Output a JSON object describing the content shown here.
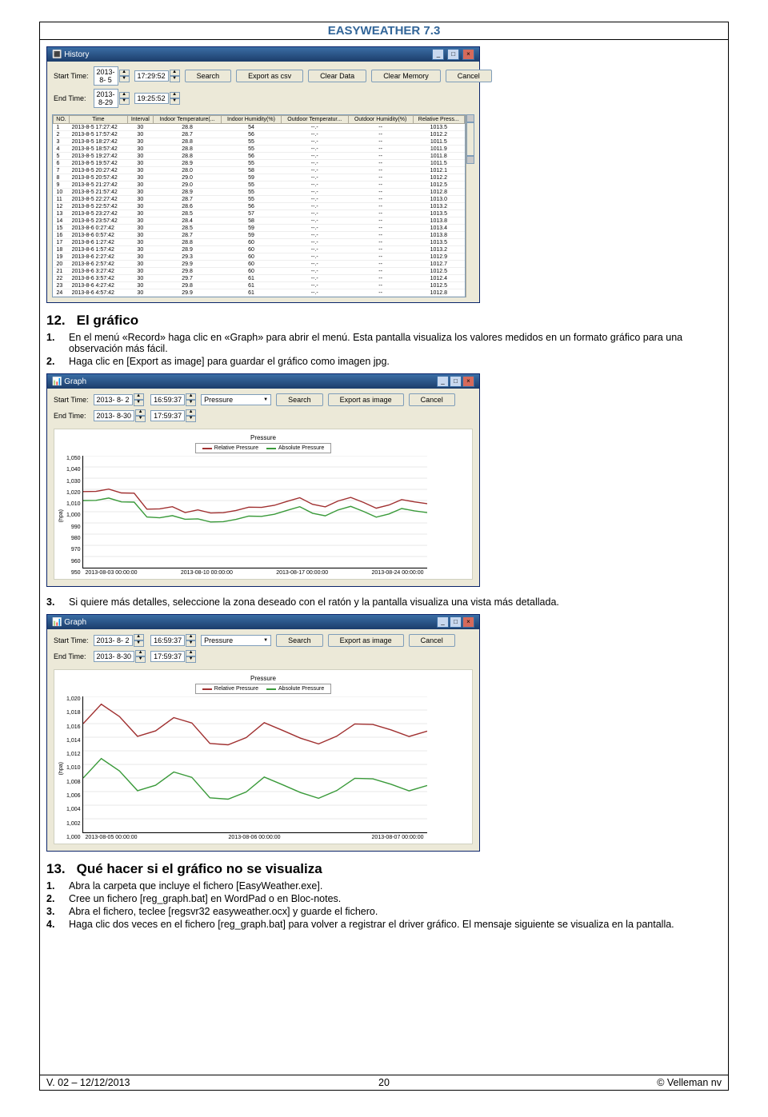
{
  "headerTitle": "EASYWEATHER 7.3",
  "footer": {
    "left": "V. 02 – 12/12/2013",
    "page": "20",
    "right": "© Velleman nv"
  },
  "historyWin": {
    "title": "History",
    "startLabel": "Start Time:",
    "endLabel": "End Time:",
    "startDate": "2013- 8-  5",
    "startTime": "17:29:52",
    "endDate": "2013- 8-29",
    "endTime": "19:25:52",
    "btnSearch": "Search",
    "btnExportCsv": "Export as csv",
    "btnClearData": "Clear Data",
    "btnClearMem": "Clear Memory",
    "btnCancel": "Cancel",
    "headers": [
      "NO.",
      "Time",
      "Interval",
      "Indoor Temperature(...",
      "Indoor Humidity(%)",
      "Outdoor Temperatur...",
      "Outdoor Humidity(%)",
      "Relative Press..."
    ],
    "rows": [
      [
        "1",
        "2013-8-5 17:27:42",
        "30",
        "28.8",
        "54",
        "--.-",
        "--",
        "1013.5"
      ],
      [
        "2",
        "2013-8-5 17:57:42",
        "30",
        "28.7",
        "56",
        "--.-",
        "--",
        "1012.2"
      ],
      [
        "3",
        "2013-8-5 18:27:42",
        "30",
        "28.8",
        "55",
        "--.-",
        "--",
        "1011.5"
      ],
      [
        "4",
        "2013-8-5 18:57:42",
        "30",
        "28.8",
        "55",
        "--.-",
        "--",
        "1011.9"
      ],
      [
        "5",
        "2013-8-5 19:27:42",
        "30",
        "28.8",
        "56",
        "--.-",
        "--",
        "1011.8"
      ],
      [
        "6",
        "2013-8-5 19:57:42",
        "30",
        "28.9",
        "55",
        "--.-",
        "--",
        "1011.5"
      ],
      [
        "7",
        "2013-8-5 20:27:42",
        "30",
        "28.0",
        "58",
        "--.-",
        "--",
        "1012.1"
      ],
      [
        "8",
        "2013-8-5 20:57:42",
        "30",
        "29.0",
        "59",
        "--.-",
        "--",
        "1012.2"
      ],
      [
        "9",
        "2013-8-5 21:27:42",
        "30",
        "29.0",
        "55",
        "--.-",
        "--",
        "1012.5"
      ],
      [
        "10",
        "2013-8-5 21:57:42",
        "30",
        "28.9",
        "55",
        "--.-",
        "--",
        "1012.8"
      ],
      [
        "11",
        "2013-8-5 22:27:42",
        "30",
        "28.7",
        "55",
        "--.-",
        "--",
        "1013.0"
      ],
      [
        "12",
        "2013-8-5 22:57:42",
        "30",
        "28.6",
        "56",
        "--.-",
        "--",
        "1013.2"
      ],
      [
        "13",
        "2013-8-5 23:27:42",
        "30",
        "28.5",
        "57",
        "--.-",
        "--",
        "1013.5"
      ],
      [
        "14",
        "2013-8-5 23:57:42",
        "30",
        "28.4",
        "58",
        "--.-",
        "--",
        "1013.8"
      ],
      [
        "15",
        "2013-8-6 0:27:42",
        "30",
        "28.5",
        "59",
        "--.-",
        "--",
        "1013.4"
      ],
      [
        "16",
        "2013-8-6 0:57:42",
        "30",
        "28.7",
        "59",
        "--.-",
        "--",
        "1013.8"
      ],
      [
        "17",
        "2013-8-6 1:27:42",
        "30",
        "28.8",
        "60",
        "--.-",
        "--",
        "1013.5"
      ],
      [
        "18",
        "2013-8-6 1:57:42",
        "30",
        "28.9",
        "60",
        "--.-",
        "--",
        "1013.2"
      ],
      [
        "19",
        "2013-8-6 2:27:42",
        "30",
        "29.3",
        "60",
        "--.-",
        "--",
        "1012.9"
      ],
      [
        "20",
        "2013-8-6 2:57:42",
        "30",
        "29.9",
        "60",
        "--.-",
        "--",
        "1012.7"
      ],
      [
        "21",
        "2013-8-6 3:27:42",
        "30",
        "29.8",
        "60",
        "--.-",
        "--",
        "1012.5"
      ],
      [
        "22",
        "2013-8-6 3:57:42",
        "30",
        "29.7",
        "61",
        "--.-",
        "--",
        "1012.4"
      ],
      [
        "23",
        "2013-8-6 4:27:42",
        "30",
        "29.8",
        "61",
        "--.-",
        "--",
        "1012.5"
      ],
      [
        "24",
        "2013-8-6 4:57:42",
        "30",
        "29.9",
        "61",
        "--.-",
        "--",
        "1012.8"
      ]
    ]
  },
  "section12": {
    "title": "El gráfico",
    "num": "12.",
    "items": [
      {
        "n": "1.",
        "t": "En el menú «Record» haga clic en «Graph» para abrir el menú. Esta pantalla visualiza los valores medidos en un formato gráfico para una observación más fácil."
      },
      {
        "n": "2.",
        "t": "Haga clic en [Export as image] para guardar el gráfico como imagen jpg."
      }
    ]
  },
  "graphWin1": {
    "title": "Graph",
    "startLabel": "Start Time:",
    "endLabel": "End Time:",
    "startDate": "2013- 8-  2",
    "startTime": "16:59:37",
    "endDate": "2013- 8-30",
    "endTime": "17:59:37",
    "selectVal": "Pressure",
    "btnSearch": "Search",
    "btnExportImg": "Export as image",
    "btnCancel": "Cancel",
    "plotTitle": "Pressure",
    "legendRel": "Relative Pressure",
    "legendAbs": "Absolute Pressure",
    "yLabel": "(hpa)"
  },
  "section12b": {
    "items": [
      {
        "n": "3.",
        "t": "Si quiere más detalles, seleccione la zona deseado con el ratón y la pantalla visualiza una vista más detallada."
      }
    ]
  },
  "graphWin2": {
    "title": "Graph",
    "startLabel": "Start Time:",
    "endLabel": "End Time:",
    "startDate": "2013- 8-  2",
    "startTime": "16:59:37",
    "endDate": "2013- 8-30",
    "endTime": "17:59:37",
    "selectVal": "Pressure",
    "btnSearch": "Search",
    "btnExportImg": "Export as image",
    "btnCancel": "Cancel",
    "plotTitle": "Pressure",
    "legendRel": "Relative Pressure",
    "legendAbs": "Absolute Pressure",
    "yLabel": "(hpa)"
  },
  "section13": {
    "num": "13.",
    "title": "Qué hacer si el gráfico no se visualiza",
    "items": [
      {
        "n": "1.",
        "t": "Abra la carpeta que incluye el fichero [EasyWeather.exe]."
      },
      {
        "n": "2.",
        "t": "Cree un fichero [reg_graph.bat] en WordPad o en Bloc-notes."
      },
      {
        "n": "3.",
        "t": "Abra el fichero, teclee [regsvr32 easyweather.ocx] y guarde el fichero."
      },
      {
        "n": "4.",
        "t": "Haga clic dos veces en el fichero [reg_graph.bat] para volver a registrar el driver gráfico. El mensaje siguiente se visualiza en la pantalla."
      }
    ]
  },
  "chart_data": [
    {
      "type": "line",
      "title": "Pressure",
      "xlabel": "",
      "ylabel": "(hpa)",
      "ylim": [
        950,
        1050
      ],
      "yticks": [
        950,
        960,
        970,
        980,
        990,
        1000,
        1010,
        1020,
        1030,
        1040,
        1050
      ],
      "xticks": [
        "2013-08-03 00:00:00",
        "2013-08-10 00:00:00",
        "2013-08-17 00:00:00",
        "2013-08-24 00:00:00"
      ],
      "series": [
        {
          "name": "Relative Pressure",
          "color": "#a03030",
          "values": [
            1018,
            1019,
            1020,
            1016,
            1017,
            1003,
            1002,
            1004,
            1000,
            1002,
            998,
            999,
            1002,
            1004,
            1003,
            1006,
            1010,
            1012,
            1006,
            1005,
            1010,
            1012,
            1008,
            1004,
            1006,
            1010,
            1009,
            1008
          ]
        },
        {
          "name": "Absolute Pressure",
          "color": "#3a9a3a",
          "values": [
            1010,
            1011,
            1012,
            1008,
            1009,
            996,
            994,
            996,
            994,
            994,
            990,
            991,
            994,
            996,
            995,
            998,
            1002,
            1004,
            998,
            997,
            1002,
            1004,
            1000,
            996,
            998,
            1002,
            1001,
            1000
          ]
        }
      ]
    },
    {
      "type": "line",
      "title": "Pressure",
      "xlabel": "",
      "ylabel": "(hpa)",
      "ylim": [
        1000,
        1020
      ],
      "yticks": [
        1000,
        1002,
        1004,
        1006,
        1008,
        1010,
        1012,
        1014,
        1016,
        1018,
        1020
      ],
      "xticks": [
        "2013-08-05 00:00:00",
        "2013-08-06 00:00:00",
        "2013-08-07 00:00:00"
      ],
      "series": [
        {
          "name": "Relative Pressure",
          "color": "#a03030",
          "values": [
            1016,
            1019,
            1017,
            1014,
            1015,
            1017,
            1016,
            1013,
            1013,
            1014,
            1016,
            1015,
            1014,
            1013,
            1014,
            1016,
            1016,
            1015,
            1014,
            1015
          ]
        },
        {
          "name": "Absolute Pressure",
          "color": "#3a9a3a",
          "values": [
            1008,
            1011,
            1009,
            1006,
            1007,
            1009,
            1008,
            1005,
            1005,
            1006,
            1008,
            1007,
            1006,
            1005,
            1006,
            1008,
            1008,
            1007,
            1006,
            1007
          ]
        }
      ]
    }
  ]
}
